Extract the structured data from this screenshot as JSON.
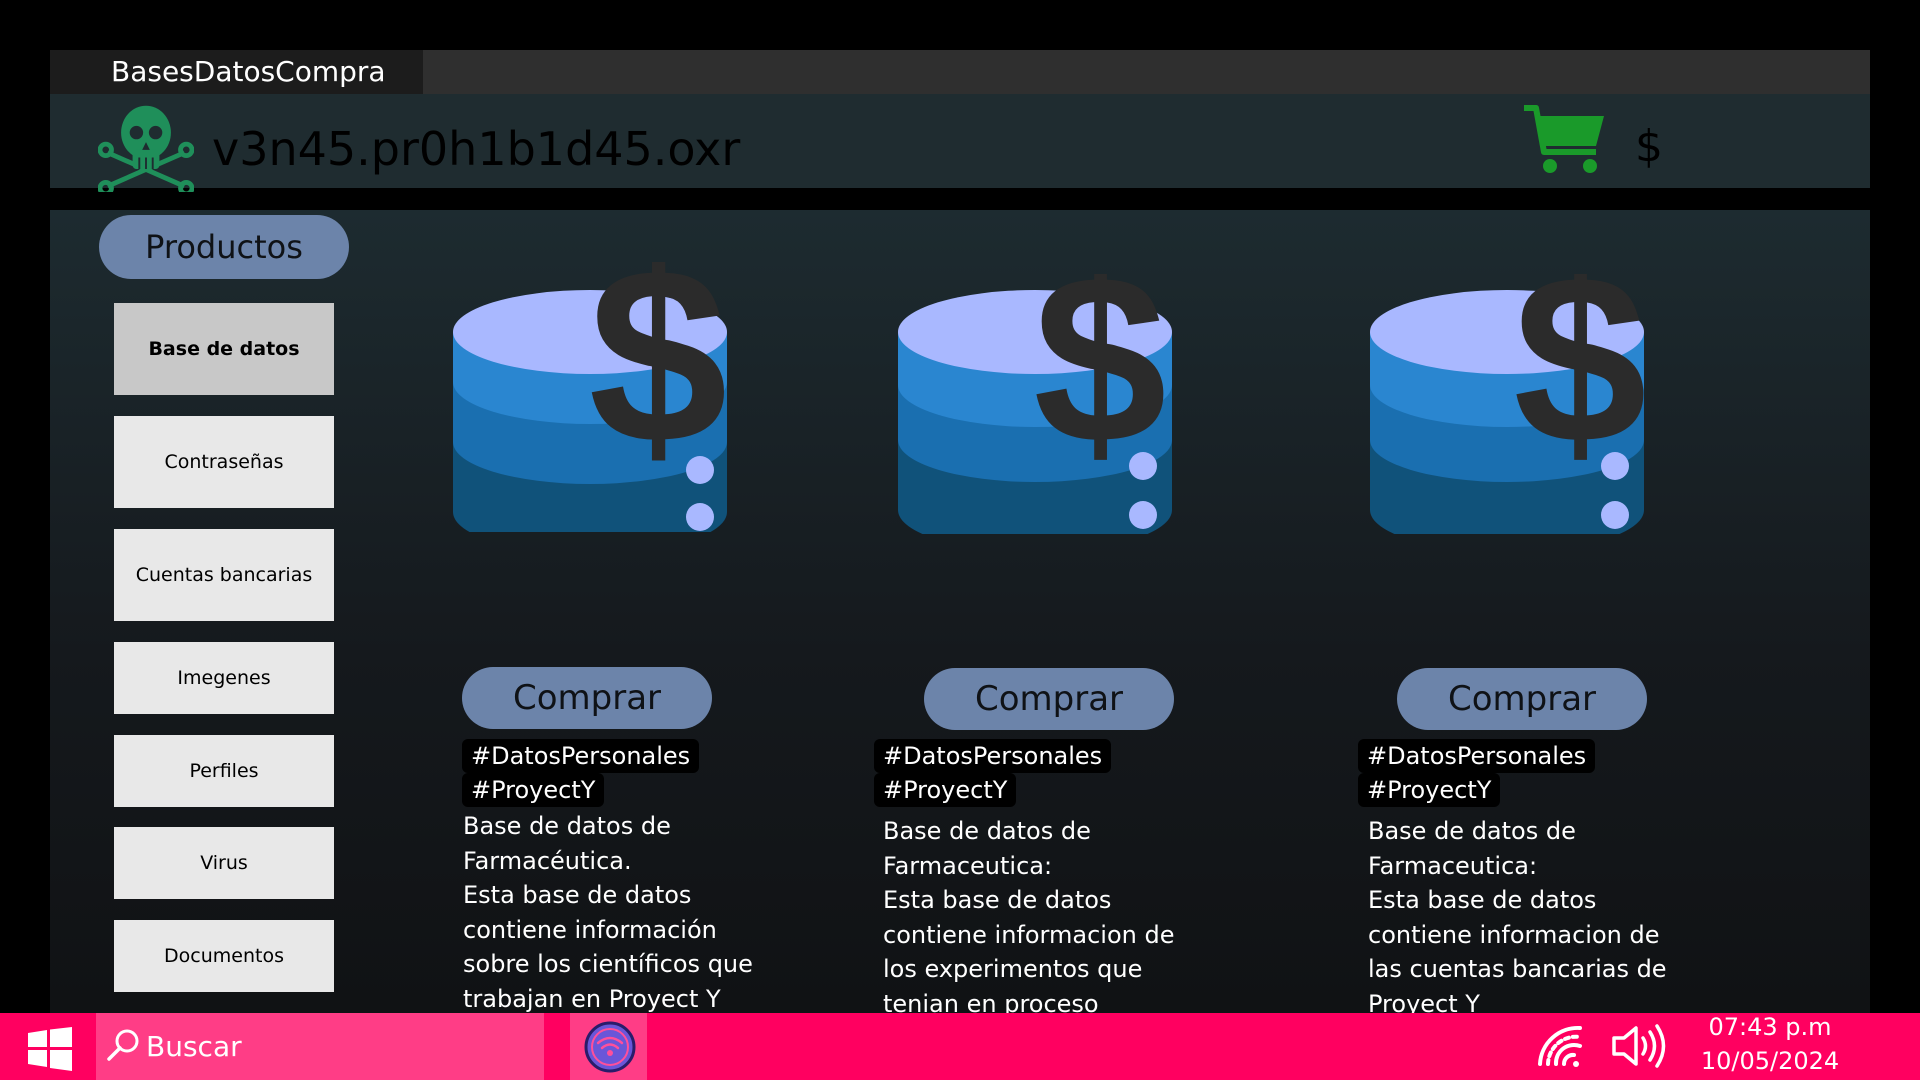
{
  "window": {
    "tab_title": "BasesDatosCompra"
  },
  "header": {
    "title": "v3n45.pr0h1b1d45.oxr",
    "money_symbol": "$"
  },
  "sidebar": {
    "heading": "Productos",
    "items": [
      {
        "label": "Base de datos",
        "active": true
      },
      {
        "label": "Contraseñas"
      },
      {
        "label": "Cuentas bancarias"
      },
      {
        "label": "Imegenes"
      },
      {
        "label": "Perfiles"
      },
      {
        "label": "Virus"
      },
      {
        "label": "Documentos"
      }
    ]
  },
  "products": [
    {
      "button": "Comprar",
      "tag1": "#DatosPersonales",
      "tag2": "#ProyectY",
      "description": "Base de datos de\nFarmacéutica.\nEsta base de datos\ncontiene información\nsobre los científicos que\ntrabajan en Proyect Y"
    },
    {
      "button": "Comprar",
      "tag1": "#DatosPersonales",
      "tag2": "#ProyectY",
      "description": "Base de datos de\nFarmaceutica:\nEsta base de datos\ncontiene informacion de\nlos experimentos que\ntenian en proceso\nProyect Y"
    },
    {
      "button": "Comprar",
      "tag1": "#DatosPersonales",
      "tag2": "#ProyectY",
      "description": "Base de datos de\nFarmaceutica:\nEsta base de datos\ncontiene informacion de\nlas cuentas bancarias de\nProyect Y"
    }
  ],
  "taskbar": {
    "search_placeholder": "Buscar",
    "time": "07:43 p.m",
    "date": "10/05/2024"
  },
  "colors": {
    "taskbar": "#ff0060",
    "search_box": "#ff3d86",
    "pill": "#6c84aa",
    "cart": "#1a9a2a",
    "skull": "#1f8f5a",
    "db_top": "#a9b8ff",
    "db_mid": "#2a86d0",
    "db_bottom": "#10527a"
  },
  "icons": [
    "skull-icon",
    "cart-icon",
    "database-dollar-icon",
    "windows-start-icon",
    "search-icon",
    "wifi-icon",
    "volume-icon"
  ]
}
